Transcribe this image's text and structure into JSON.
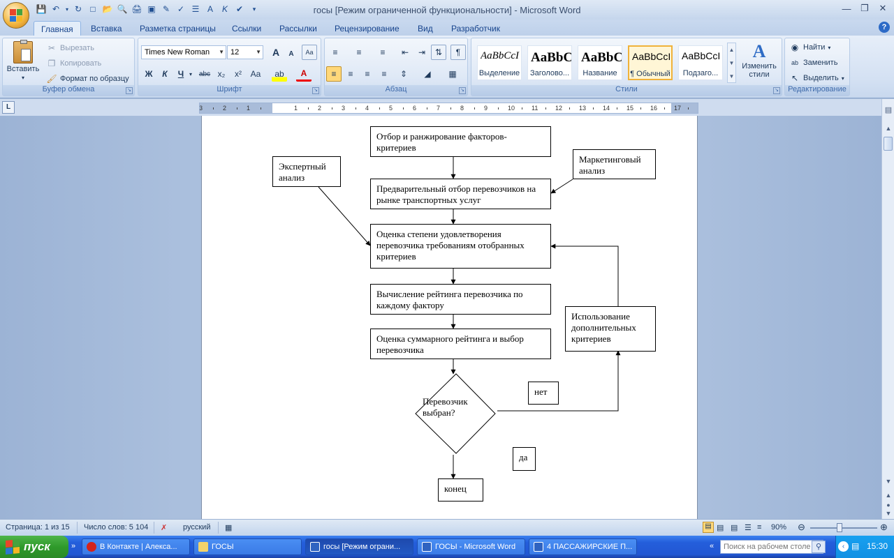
{
  "window": {
    "title": "госы [Режим ограниченной функциональности] - Microsoft Word",
    "controls": [
      "minimize-icon",
      "restore-icon",
      "close-icon"
    ]
  },
  "quick_access": [
    "save-icon",
    "undo-icon",
    "redo-icon",
    "new-icon",
    "open-icon",
    "print-preview-icon",
    "print-icon",
    "spelling-icon"
  ],
  "tabs": [
    "Главная",
    "Вставка",
    "Разметка страницы",
    "Ссылки",
    "Рассылки",
    "Рецензирование",
    "Вид",
    "Разработчик"
  ],
  "ribbon": {
    "clipboard": {
      "label": "Буфер обмена",
      "paste": "Вставить",
      "cut": "Вырезать",
      "copy": "Копировать",
      "format_painter": "Формат по образцу"
    },
    "font": {
      "label": "Шрифт",
      "font_name": "Times New Roman",
      "font_size": "12",
      "bold": "Ж",
      "italic": "К",
      "underline": "Ч",
      "strike": "abc",
      "subscript": "x₂",
      "superscript": "x²",
      "change_case": "Aa",
      "grow": "A",
      "shrink": "A"
    },
    "paragraph": {
      "label": "Абзац"
    },
    "styles": {
      "label": "Стили",
      "items": [
        {
          "preview": "AaBbCcI",
          "name": "Выделение"
        },
        {
          "preview": "AaBbC",
          "name": "Заголово..."
        },
        {
          "preview": "AaBbC",
          "name": "Название"
        },
        {
          "preview": "AaBbCcI",
          "name": "¶ Обычный"
        },
        {
          "preview": "AaBbCcI",
          "name": "Подзаго..."
        }
      ],
      "change_styles": [
        "Изменить",
        "стили"
      ]
    },
    "editing": {
      "label": "Редактирование",
      "find": "Найти",
      "replace": "Заменить",
      "select": "Выделить"
    }
  },
  "ruler": {
    "marks": [
      "3",
      "2",
      "1",
      "1",
      "2",
      "3",
      "4",
      "5",
      "6",
      "7",
      "8",
      "9",
      "10",
      "11",
      "12",
      "13",
      "14",
      "15",
      "16",
      "17"
    ]
  },
  "flowchart": {
    "step1": "Отбор и ранжирование факторов-критериев",
    "expert": "Экспертный анализ",
    "marketing": "Маркетинговый анализ",
    "step2": "Предварительный отбор перевозчиков на рынке транспортных услуг",
    "step3": "Оценка степени удовлетворения перевозчика требованиям отобранных критериев",
    "step4": "Вычисление рейтинга перевозчика по каждому фактору",
    "step5": "Оценка суммарного рейтинга и выбор перевозчика",
    "decision": "Перевозчик выбран?",
    "extra": "Использование дополнительных критериев",
    "no": "нет",
    "yes": "да",
    "end": "конец"
  },
  "status": {
    "page": "Страница: 1 из 15",
    "words": "Число слов: 5 104",
    "language": "русский",
    "zoom": "90%"
  },
  "taskbar": {
    "start": "пуск",
    "buttons": [
      "В Контакте | Алекса...",
      "ГОСЫ",
      "госы [Режим ограни...",
      "ГОСЫ - Microsoft Word",
      "4 ПАССАЖИРСКИЕ П..."
    ],
    "search_placeholder": "Поиск на рабочем столе",
    "time": "15:30"
  },
  "colors": {
    "accent": "#15428b",
    "selected_style": "#f0b23a",
    "taskbar": "#245edb",
    "start": "#2f9a2b"
  }
}
